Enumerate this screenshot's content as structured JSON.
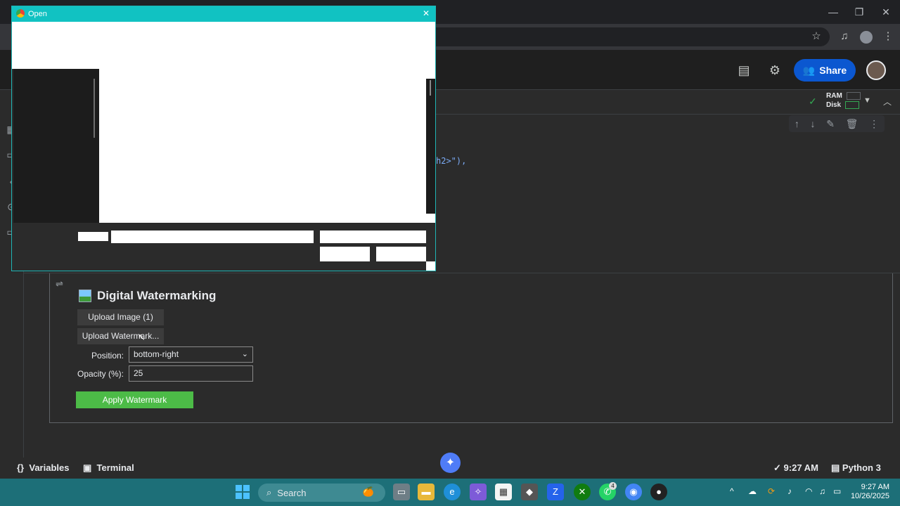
{
  "browser": {
    "window_controls": {
      "minimize": "—",
      "maximize": "❐",
      "close": "✕"
    }
  },
  "colab": {
    "share_label": "Share",
    "resources": {
      "ram": "RAM",
      "disk": "Disk"
    },
    "code_fragment": "h2>\"),",
    "output": {
      "title": "Digital Watermarking",
      "upload_image_label": "Upload Image (1)",
      "upload_watermark_label": "Upload Watermark...",
      "position_label": "Position:",
      "position_value": "bottom-right",
      "opacity_label": "Opacity (%):",
      "opacity_value": "25",
      "apply_label": "Apply Watermark"
    },
    "statusbar": {
      "variables": "Variables",
      "terminal": "Terminal",
      "time_status": "9:27 AM",
      "runtime": "Python 3"
    }
  },
  "dialog": {
    "title": "Open",
    "close": "✕"
  },
  "taskbar": {
    "search_label": "Search",
    "clock_time": "9:27 AM",
    "clock_date": "10/26/2025",
    "whatsapp_badge": "4"
  },
  "icons": {
    "accent_share": "#0b57d0",
    "apply_green": "#4cbb47",
    "dialog_title": "#11c2c2",
    "taskbar": "#1d6f78"
  }
}
